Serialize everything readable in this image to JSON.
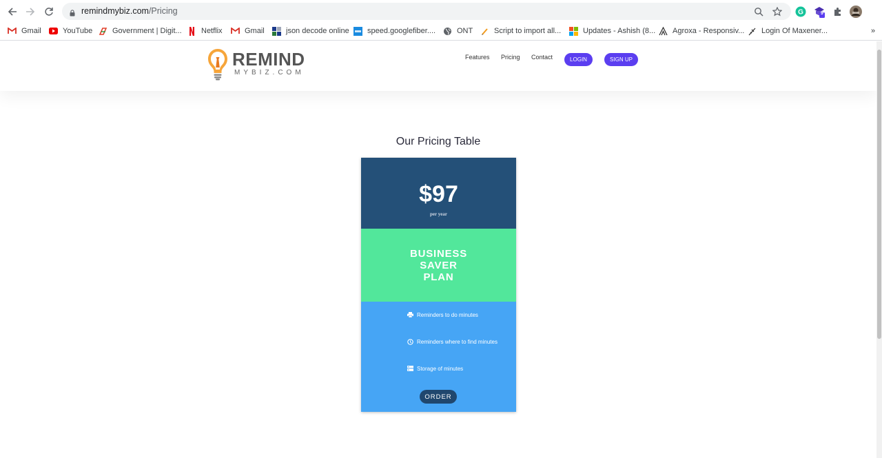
{
  "browser": {
    "url_host": "remindmybiz.com",
    "url_path": "/Pricing",
    "extension_badge": "9",
    "bookmarks": [
      {
        "label": "Gmail",
        "icon": "gmail-icon"
      },
      {
        "label": "YouTube",
        "icon": "youtube-icon"
      },
      {
        "label": "Government | Digit...",
        "icon": "government-icon"
      },
      {
        "label": "Netflix",
        "icon": "netflix-icon"
      },
      {
        "label": "Gmail",
        "icon": "gmail-icon"
      },
      {
        "label": "json decode online",
        "icon": "json-icon"
      },
      {
        "label": "speed.googlefiber....",
        "icon": "fiber-icon"
      },
      {
        "label": "ONT",
        "icon": "globe-icon"
      },
      {
        "label": "Script to import all...",
        "icon": "script-icon"
      },
      {
        "label": "Updates - Ashish (8...",
        "icon": "microsoft-icon"
      },
      {
        "label": "Agroxa - Responsiv...",
        "icon": "agroxa-icon"
      },
      {
        "label": "Login Of Maxener...",
        "icon": "maxener-icon"
      }
    ],
    "overflow": "»"
  },
  "site": {
    "logo_word": "REMIND",
    "logo_sub": "MYBIZ.COM",
    "nav": {
      "features": "Features",
      "pricing": "Pricing",
      "contact": "Contact",
      "login": "LOGIN",
      "signup": "SIGN UP"
    }
  },
  "main": {
    "title": "Our Pricing Table",
    "card": {
      "price": "$97",
      "period": "per year",
      "plan_line1": "BUSINESS",
      "plan_line2": "SAVER",
      "plan_line3": "PLAN",
      "features": [
        {
          "label": "Reminders to do minutes",
          "icon": "printer-icon"
        },
        {
          "label": "Reminders where to find minutes",
          "icon": "clock-icon"
        },
        {
          "label": "Storage of minutes",
          "icon": "storage-icon"
        }
      ],
      "order": "ORDER"
    }
  },
  "colors": {
    "brand_purple": "#5b3ef0",
    "price_bg": "#245078",
    "plan_bg": "#52e79b",
    "features_bg": "#46a5f5",
    "order_bg": "#20476e"
  }
}
